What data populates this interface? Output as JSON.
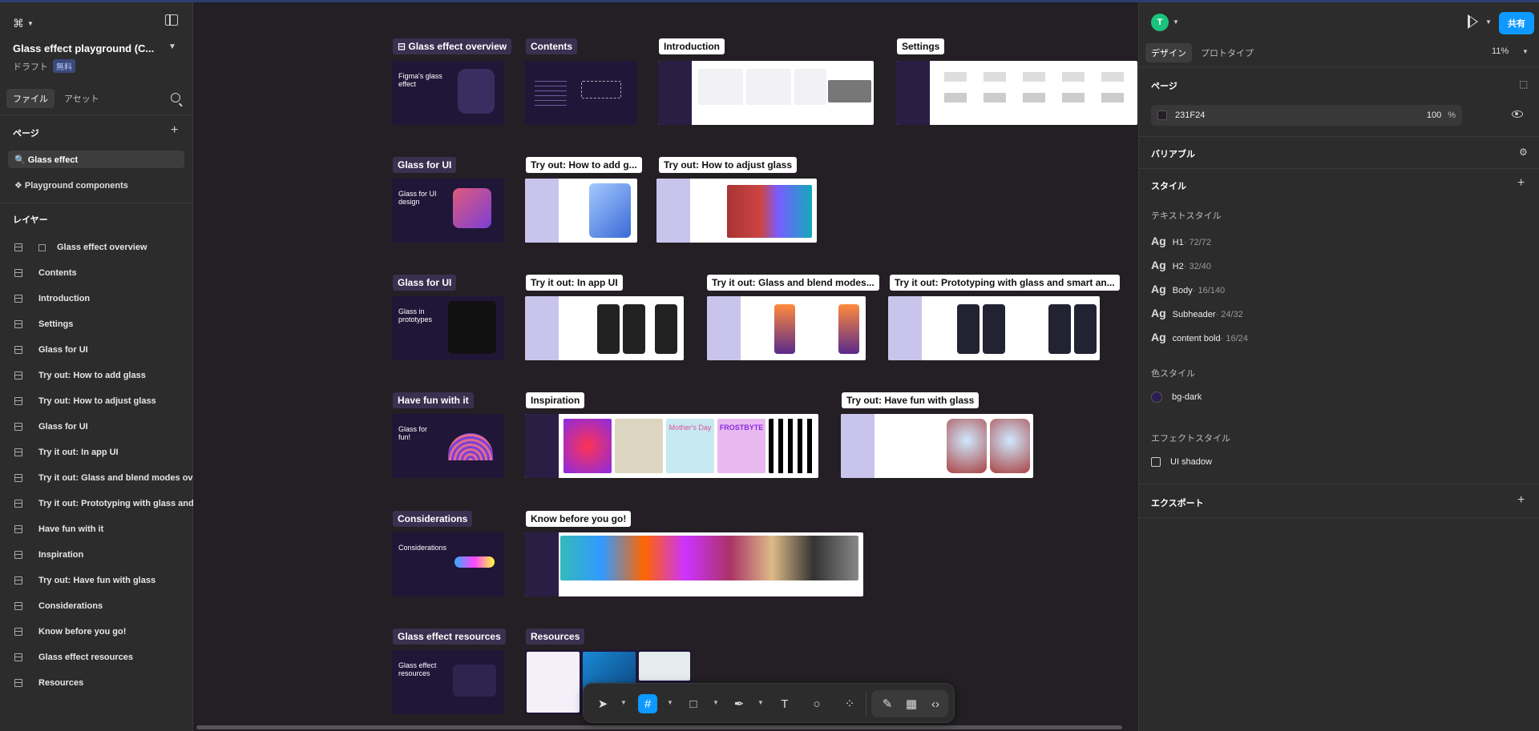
{
  "app": {
    "file_title": "Glass effect playground (C...",
    "draft_label": "ドラフト",
    "plan_badge": "無料",
    "tab_file": "ファイル",
    "tab_assets": "アセット"
  },
  "pages": {
    "title": "ページ",
    "items": [
      {
        "label": "🔍 Glass effect"
      },
      {
        "label": "❖ Playground components"
      }
    ]
  },
  "layers": {
    "title": "レイヤー",
    "items": [
      {
        "label": "Glass effect overview"
      },
      {
        "label": "Contents"
      },
      {
        "label": "Introduction"
      },
      {
        "label": "Settings"
      },
      {
        "label": "Glass for UI"
      },
      {
        "label": "Try out: How to add glass"
      },
      {
        "label": "Try out: How to adjust glass"
      },
      {
        "label": "Glass for UI"
      },
      {
        "label": "Try it out: In app UI"
      },
      {
        "label": "Try it out: Glass and blend modes ove"
      },
      {
        "label": "Try it out: Prototyping with glass and"
      },
      {
        "label": "Have fun with it"
      },
      {
        "label": "Inspiration"
      },
      {
        "label": "Try out: Have fun with glass"
      },
      {
        "label": "Considerations"
      },
      {
        "label": "Know before you go!"
      },
      {
        "label": "Glass effect resources"
      },
      {
        "label": "Resources"
      }
    ]
  },
  "canvas": {
    "frames": {
      "overview": "⊟ Glass effect overview",
      "contents": "Contents",
      "introduction": "Introduction",
      "settings": "Settings",
      "glass_for_ui_1": "Glass for UI",
      "how_to_add": "Try out: How to add g...",
      "how_to_adjust": "Try out: How to adjust glass",
      "glass_for_ui_2": "Glass for UI",
      "in_app_ui": "Try it out: In app UI",
      "blend_modes": "Try it out: Glass and blend modes...",
      "prototyping": "Try it out: Prototyping with glass and smart an...",
      "have_fun": "Have fun with it",
      "inspiration": "Inspiration",
      "have_fun_glass": "Try out: Have fun with glass",
      "considerations": "Considerations",
      "know_before": "Know before you go!",
      "resources_section": "Glass effect resources",
      "resources": "Resources"
    },
    "thumb_text": {
      "overview": "Figma's glass effect",
      "glass_ui_design": "Glass for UI design",
      "glass_prototypes": "Glass in prototypes",
      "glass_fun": "Glass for fun!",
      "considerations": "Considerations",
      "resources": "Glass effect resources",
      "mothers_day": "Mother's Day",
      "frostbyte": "FROSTBYTE"
    }
  },
  "right_panel": {
    "avatar_initial": "T",
    "share_label": "共有",
    "tab_design": "デザイン",
    "tab_prototype": "プロトタイプ",
    "zoom": "11%",
    "page_section": "ページ",
    "bg_hex": "231F24",
    "bg_opacity": "100",
    "bg_pct": "%",
    "variables": "バリアブル",
    "styles": "スタイル",
    "text_styles_title": "テキストスタイル",
    "text_styles": [
      {
        "ag": "Ag",
        "name": "H1",
        "meta": " · 72/72"
      },
      {
        "ag": "Ag",
        "name": "H2",
        "meta": " · 32/40"
      },
      {
        "ag": "Ag",
        "name": "Body",
        "meta": " · 16/140"
      },
      {
        "ag": "Ag",
        "name": "Subheader",
        "meta": " · 24/32"
      },
      {
        "ag": "Ag",
        "name": "content bold",
        "meta": " · 16/24"
      }
    ],
    "color_styles_title": "色スタイル",
    "color_style": "bg-dark",
    "effect_styles_title": "エフェクトスタイル",
    "effect_style": "UI shadow",
    "export": "エクスポート"
  },
  "colors": {
    "accent": "#0d99ff",
    "canvas_bg": "#231f24",
    "panel_bg": "#2c2c2c",
    "avatar": "#1bc47d"
  }
}
